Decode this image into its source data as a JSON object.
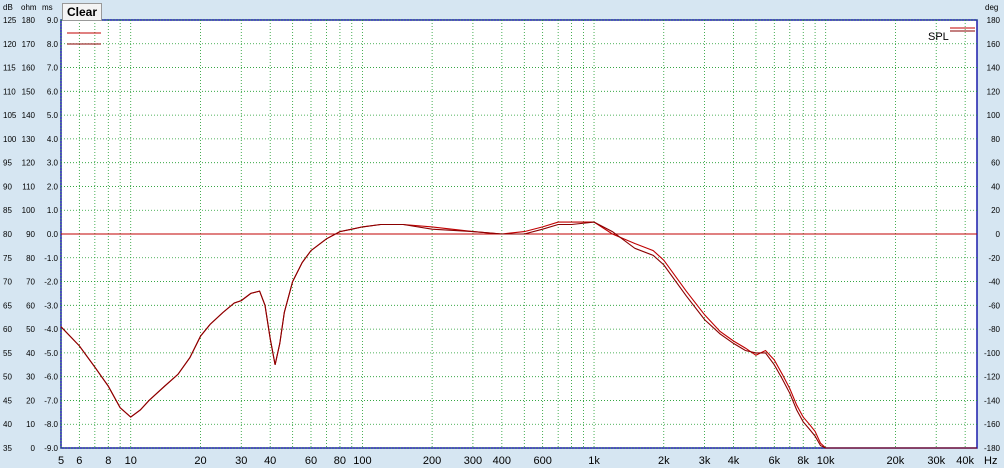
{
  "toolbar": {
    "clear_label": "Clear"
  },
  "axis_headers": {
    "db": "dB",
    "ohm": "ohm",
    "ms": "ms",
    "deg": "deg",
    "hz": "Hz"
  },
  "colors": {
    "background": "#d6e6f2",
    "plot": "#ffffff",
    "grid": "#1a9a2a",
    "curve": "#c00000",
    "curve2": "#8a0000",
    "zero_line": "#c00000",
    "frame": "#1a1aaa"
  },
  "chart_data": {
    "type": "line",
    "x_scale": "log",
    "xlim": [
      5,
      45000
    ],
    "ylim": [
      35,
      125
    ],
    "y_ticks": {
      "db": [
        "125",
        "120",
        "115",
        "110",
        "105",
        "100",
        "95",
        "90",
        "85",
        "80",
        "75",
        "70",
        "65",
        "60",
        "55",
        "50",
        "45",
        "40",
        "35"
      ],
      "ohm": [
        "180",
        "170",
        "160",
        "150",
        "140",
        "130",
        "120",
        "110",
        "100",
        "90",
        "80",
        "70",
        "60",
        "50",
        "40",
        "30",
        "20",
        "10",
        "0"
      ],
      "ms": [
        "9.0",
        "8.0",
        "7.0",
        "6.0",
        "5.0",
        "4.0",
        "3.0",
        "2.0",
        "1.0",
        "0.0",
        "-1.0",
        "-2.0",
        "-3.0",
        "-4.0",
        "-5.0",
        "-6.0",
        "-7.0",
        "-8.0",
        "-9.0"
      ]
    },
    "y2_ticks": [
      "180",
      "160",
      "140",
      "120",
      "100",
      "80",
      "60",
      "40",
      "20",
      "0",
      "-20",
      "-40",
      "-60",
      "-80",
      "-100",
      "-120",
      "-140",
      "-160",
      "-180"
    ],
    "x_tick_labels": [
      {
        "v": 5,
        "t": "5"
      },
      {
        "v": 6,
        "t": "6"
      },
      {
        "v": 8,
        "t": "8"
      },
      {
        "v": 10,
        "t": "10"
      },
      {
        "v": 20,
        "t": "20"
      },
      {
        "v": 30,
        "t": "30"
      },
      {
        "v": 40,
        "t": "40"
      },
      {
        "v": 60,
        "t": "60"
      },
      {
        "v": 80,
        "t": "80"
      },
      {
        "v": 100,
        "t": "100"
      },
      {
        "v": 200,
        "t": "200"
      },
      {
        "v": 300,
        "t": "300"
      },
      {
        "v": 400,
        "t": "400"
      },
      {
        "v": 600,
        "t": "600"
      },
      {
        "v": 1000,
        "t": "1k"
      },
      {
        "v": 2000,
        "t": "2k"
      },
      {
        "v": 3000,
        "t": "3k"
      },
      {
        "v": 4000,
        "t": "4k"
      },
      {
        "v": 6000,
        "t": "6k"
      },
      {
        "v": 8000,
        "t": "8k"
      },
      {
        "v": 10000,
        "t": "10k"
      },
      {
        "v": 20000,
        "t": "20k"
      },
      {
        "v": 30000,
        "t": "30k"
      },
      {
        "v": 40000,
        "t": "40k"
      }
    ],
    "reference_line_db": 80,
    "legend": {
      "placement": "top-right",
      "label": "SPL"
    },
    "series": [
      {
        "x": [
          5,
          6,
          7,
          8,
          9,
          10,
          11,
          12,
          14,
          16,
          18,
          20,
          22,
          25,
          28,
          30,
          33,
          36,
          38,
          40,
          42,
          44,
          46,
          50,
          55,
          60,
          70,
          80,
          90,
          100,
          120,
          150,
          200,
          300,
          400,
          500,
          600,
          700,
          800,
          1000,
          1200,
          1500,
          1800,
          2000,
          2500,
          3000,
          3500,
          4000,
          4500,
          5000,
          5500,
          6000,
          6500,
          7000,
          7500,
          8000,
          8500,
          9000,
          9500,
          10000,
          10500,
          20000,
          45000
        ],
        "y": [
          60.5,
          56.5,
          52.0,
          48.0,
          43.5,
          41.5,
          43.0,
          45.0,
          48.0,
          50.5,
          54.0,
          58.5,
          61.0,
          63.5,
          65.5,
          66.0,
          67.5,
          68.0,
          65.0,
          58.0,
          52.5,
          57.0,
          63.5,
          70.0,
          74.0,
          76.5,
          79.0,
          80.5,
          81.0,
          81.5,
          82.0,
          82.0,
          81.5,
          80.5,
          80.0,
          80.5,
          81.5,
          82.5,
          82.5,
          82.5,
          80.0,
          78.0,
          76.5,
          74.5,
          68.0,
          63.0,
          59.5,
          57.5,
          56.0,
          54.5,
          55.5,
          53.5,
          50.5,
          47.5,
          44.0,
          41.5,
          40.0,
          38.5,
          36.0,
          35.0,
          35.0,
          35.0,
          35.0
        ]
      },
      {
        "x": [
          5,
          6,
          7,
          8,
          9,
          10,
          11,
          12,
          14,
          16,
          18,
          20,
          22,
          25,
          28,
          30,
          33,
          36,
          38,
          40,
          42,
          44,
          46,
          50,
          55,
          60,
          70,
          80,
          90,
          100,
          120,
          150,
          200,
          300,
          400,
          500,
          600,
          700,
          800,
          1000,
          1200,
          1500,
          1800,
          2000,
          2500,
          3000,
          3500,
          4000,
          4500,
          5000,
          5500,
          6000,
          6500,
          7000,
          7500,
          8000,
          8500,
          9000,
          9500,
          10000,
          10500,
          20000,
          45000
        ],
        "y": [
          60.5,
          56.5,
          52.0,
          48.0,
          43.5,
          41.5,
          43.0,
          45.0,
          48.0,
          50.5,
          54.0,
          58.5,
          61.0,
          63.5,
          65.5,
          66.0,
          67.5,
          68.0,
          65.0,
          58.0,
          52.5,
          57.0,
          63.5,
          70.0,
          74.0,
          76.5,
          79.0,
          80.5,
          81.0,
          81.5,
          82.0,
          82.0,
          81.0,
          80.5,
          80.0,
          80.0,
          81.0,
          82.0,
          82.0,
          82.5,
          80.5,
          77.0,
          75.5,
          73.5,
          67.0,
          62.0,
          59.0,
          57.0,
          55.5,
          55.0,
          55.0,
          52.5,
          49.5,
          46.5,
          43.0,
          40.5,
          39.0,
          37.5,
          35.5,
          35.0,
          35.0,
          35.0,
          35.0
        ]
      }
    ]
  }
}
